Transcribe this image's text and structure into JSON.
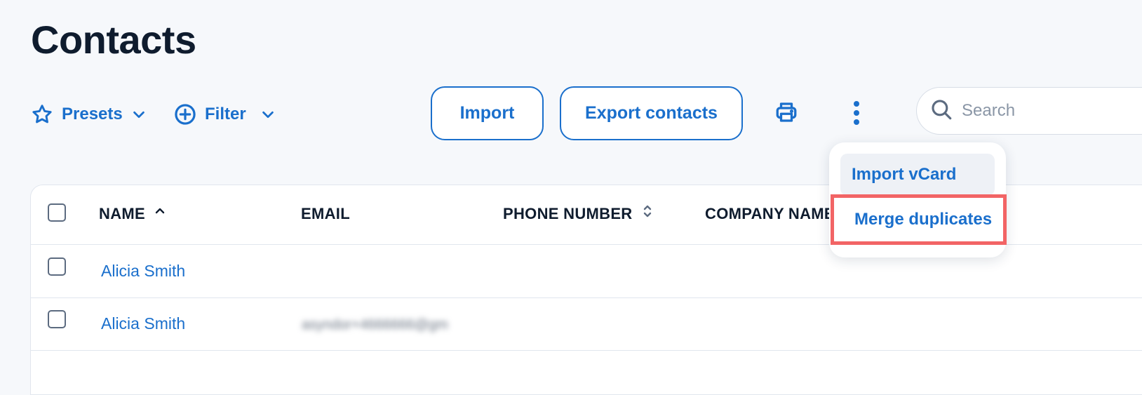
{
  "page": {
    "title": "Contacts"
  },
  "toolbar": {
    "presets_label": "Presets",
    "filter_label": "Filter",
    "import_label": "Import",
    "export_label": "Export contacts",
    "search_placeholder": "Search"
  },
  "more_menu": {
    "items": [
      {
        "label": "Import vCard"
      },
      {
        "label": "Merge duplicates"
      }
    ]
  },
  "table": {
    "columns": [
      {
        "label": "NAME"
      },
      {
        "label": "EMAIL"
      },
      {
        "label": "PHONE NUMBER"
      },
      {
        "label": "COMPANY NAME"
      }
    ],
    "rows": [
      {
        "name": "Alicia Smith",
        "email": ""
      },
      {
        "name": "Alicia Smith",
        "email": "asyndor+4666666@gm"
      }
    ]
  },
  "colors": {
    "accent": "#1a6fcc",
    "highlight_border": "#f26465",
    "page_background": "#f6f8fb"
  },
  "icons": {
    "presets": "star-icon",
    "filter": "plus-circle-icon",
    "print": "printer-icon",
    "more": "kebab-menu-icon",
    "search": "search-icon"
  }
}
